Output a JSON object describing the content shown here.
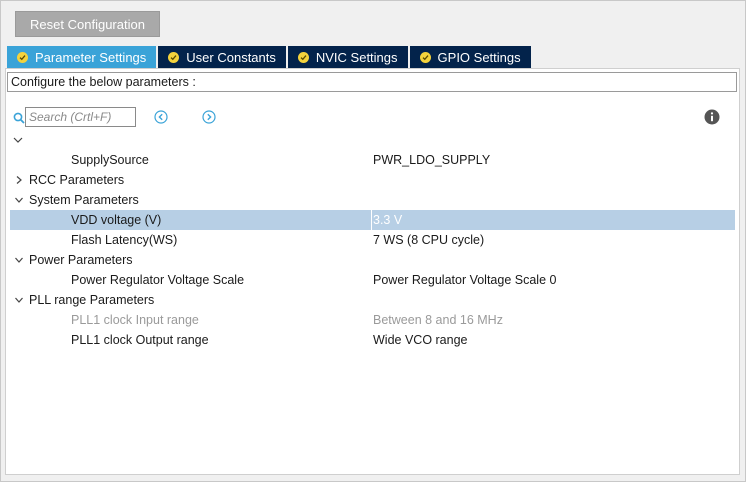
{
  "toolbar": {
    "reset_label": "Reset Configuration"
  },
  "tabs": [
    {
      "label": "Parameter Settings",
      "active": true
    },
    {
      "label": "User Constants",
      "active": false
    },
    {
      "label": "NVIC Settings",
      "active": false
    },
    {
      "label": "GPIO Settings",
      "active": false
    }
  ],
  "configure_label": "Configure the below parameters :",
  "search": {
    "placeholder": "Search (Crtl+F)",
    "value": ""
  },
  "icons": {
    "search": "search-icon",
    "prev": "circle-arrow-left-icon",
    "next": "circle-arrow-right-icon",
    "info": "info-icon",
    "expanded": "chevron-down-icon",
    "collapsed": "chevron-right-icon"
  },
  "tree": {
    "supply_source": {
      "name": "SupplySource",
      "value": "PWR_LDO_SUPPLY"
    },
    "rcc": {
      "label": "RCC Parameters",
      "expanded": false
    },
    "system": {
      "label": "System Parameters",
      "expanded": true,
      "vdd": {
        "name": "VDD voltage (V)",
        "value": "3.3 V",
        "selected": true
      },
      "flash": {
        "name": "Flash Latency(WS)",
        "value": "7 WS (8 CPU cycle)"
      }
    },
    "power": {
      "label": "Power Parameters",
      "expanded": true,
      "regulator": {
        "name": "Power Regulator Voltage Scale",
        "value": "Power Regulator Voltage Scale 0"
      }
    },
    "pll": {
      "label": "PLL range Parameters",
      "expanded": true,
      "input": {
        "name": "PLL1 clock Input range",
        "value": "Between 8 and 16 MHz",
        "disabled": true
      },
      "output": {
        "name": "PLL1 clock Output range",
        "value": "Wide VCO range"
      }
    }
  },
  "colors": {
    "tab_active": "#3aa3d8",
    "tab_inactive": "#03234b",
    "check_badge": "#f4d33c",
    "row_selected": "#b7cfe5",
    "accent_icons": "#3aa3d8"
  }
}
